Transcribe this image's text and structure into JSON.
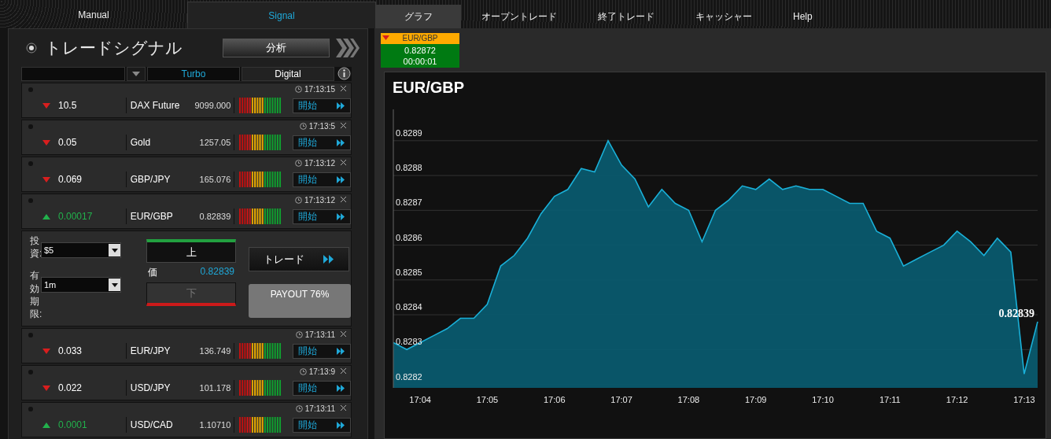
{
  "mode_tabs": [
    {
      "label": "Manual",
      "selected": false
    },
    {
      "label": "Signal",
      "selected": true
    }
  ],
  "nav_tabs": [
    {
      "label": "グラフ",
      "selected": true
    },
    {
      "label": "オープントレード",
      "selected": false
    },
    {
      "label": "終了トレード",
      "selected": false
    },
    {
      "label": "キャッシャー",
      "selected": false
    },
    {
      "label": "Help",
      "selected": false
    }
  ],
  "signal_panel": {
    "title": "トレードシグナル",
    "analysis_button": "分析",
    "filter_tabs": [
      {
        "label": "Turbo",
        "selected": true
      },
      {
        "label": "Digital",
        "selected": false
      }
    ],
    "rows": [
      {
        "time": "17:13:15",
        "rising": false,
        "change": "10.5",
        "name": "DAX Future",
        "price": "9099.000",
        "button": "開始"
      },
      {
        "time": "17:13:5",
        "rising": false,
        "change": "0.05",
        "name": "Gold",
        "price": "1257.05",
        "button": "開始"
      },
      {
        "time": "17:13:12",
        "rising": false,
        "change": "0.069",
        "name": "GBP/JPY",
        "price": "165.076",
        "button": "開始"
      },
      {
        "time": "17:13:12",
        "rising": true,
        "change": "0.00017",
        "name": "EUR/GBP",
        "price": "0.82839",
        "button": "開始"
      },
      {
        "time": "17:13:11",
        "rising": false,
        "change": "0.033",
        "name": "EUR/JPY",
        "price": "136.749",
        "button": "開始"
      },
      {
        "time": "17:13:9",
        "rising": false,
        "change": "0.022",
        "name": "USD/JPY",
        "price": "101.178",
        "button": "開始"
      },
      {
        "time": "17:13:11",
        "rising": true,
        "change": "0.0001",
        "name": "USD/CAD",
        "price": "1.10710",
        "button": "開始"
      }
    ],
    "trade_form": {
      "investment_label": "投資:",
      "investment": "$5",
      "expiry_label": "有効期限:",
      "expiry": "1m",
      "up_button": "上",
      "price_label": "価",
      "price": "0.82839",
      "down_button": "下",
      "down_disabled": true,
      "trade_button": "トレード",
      "payout": "PAYOUT 76%"
    }
  },
  "ticker": {
    "symbol": "EUR/GBP",
    "rising": false,
    "price": "0.82872",
    "timer": "00:00:01"
  },
  "chart": {
    "title": "EUR/GBP",
    "chart_data": {
      "type": "area",
      "categories": [
        null,
        null,
        "17:04",
        null,
        null,
        null,
        null,
        "17:05",
        null,
        null,
        null,
        null,
        "17:06",
        null,
        null,
        null,
        null,
        "17:07",
        null,
        null,
        null,
        null,
        "17:08",
        null,
        null,
        null,
        null,
        "17:09",
        null,
        null,
        null,
        null,
        "17:10",
        null,
        null,
        null,
        null,
        "17:11",
        null,
        null,
        null,
        null,
        "17:12",
        null,
        null,
        null,
        null,
        "17:13",
        null
      ],
      "grid": true,
      "series": [
        {
          "color": "#1ab0d8",
          "values": [
            0.82832,
            0.8283,
            0.82832,
            0.82834,
            0.82836,
            0.82839,
            0.82839,
            0.82843,
            0.82854,
            0.82857,
            0.82862,
            0.82869,
            0.82874,
            0.82876,
            0.82882,
            0.82881,
            0.8289,
            0.82883,
            0.82879,
            0.82871,
            0.82876,
            0.82872,
            0.8287,
            0.82861,
            0.8287,
            0.82873,
            0.82877,
            0.82876,
            0.82879,
            0.82876,
            0.82877,
            0.82876,
            0.82876,
            0.82874,
            0.82872,
            0.82872,
            0.82864,
            0.82862,
            0.82854,
            0.82856,
            0.82858,
            0.8286,
            0.82864,
            0.82861,
            0.82857,
            0.82862,
            0.82858,
            0.82823,
            0.82838
          ]
        }
      ],
      "ylim": [
        0.82819,
        0.82899
      ],
      "yticks": [
        0.8282,
        0.8283,
        0.8284,
        0.8285,
        0.8286,
        0.8287,
        0.8288,
        0.8289
      ],
      "annotations": [
        {
          "y": 0.82839,
          "text": "0.82839"
        }
      ]
    }
  }
}
